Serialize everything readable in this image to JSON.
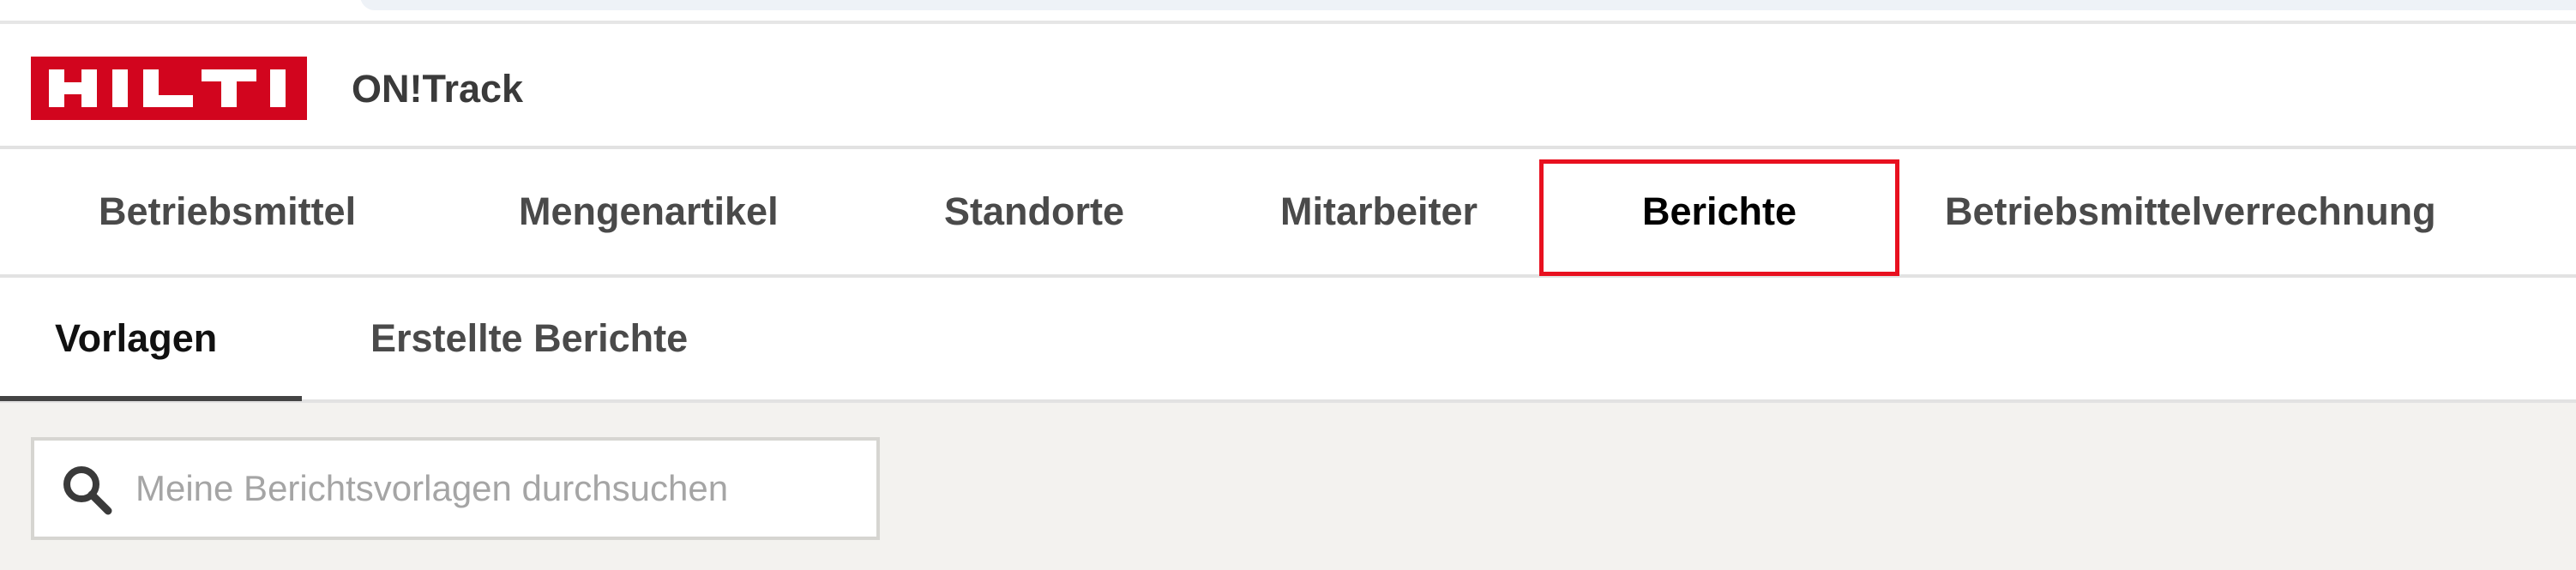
{
  "brand": {
    "logo_text": "HILTI",
    "logo_color": "#d2051e",
    "app_title": "ON!Track"
  },
  "main_nav": {
    "tabs": [
      {
        "label": "Betriebsmittel"
      },
      {
        "label": "Mengenartikel"
      },
      {
        "label": "Standorte"
      },
      {
        "label": "Mitarbeiter"
      },
      {
        "label": "Berichte",
        "active": true,
        "highlighted": true
      },
      {
        "label": "Betriebsmittelverrechnung"
      }
    ],
    "highlight_color": "#e8101f"
  },
  "sub_nav": {
    "tabs": [
      {
        "label": "Vorlagen",
        "active": true
      },
      {
        "label": "Erstellte Berichte"
      }
    ]
  },
  "search": {
    "placeholder": "Meine Berichtsvorlagen durchsuchen",
    "value": "",
    "icon": "search-icon"
  }
}
